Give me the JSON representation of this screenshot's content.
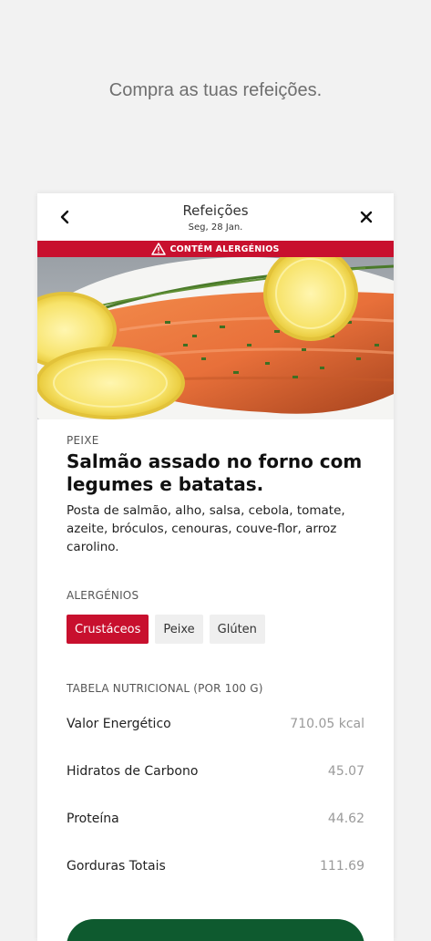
{
  "tagline": "Compra as tuas refeições.",
  "header": {
    "title": "Refeições",
    "date": "Seg, 28 Jan."
  },
  "banner": {
    "text": "CONTÉM ALERGÉNIOS",
    "icon": "warning-icon"
  },
  "meal": {
    "category": "PEIXE",
    "title": "Salmão assado no forno com legumes e batatas.",
    "description": "Posta de salmão, alho, salsa, cebola, tomate, azeite, bróculos, cenouras, couve-flor, arroz carolino."
  },
  "allergens": {
    "label": "ALERGÉNIOS",
    "tags": [
      {
        "label": "Crustáceos",
        "active": true
      },
      {
        "label": "Peixe",
        "active": false
      },
      {
        "label": "Glúten",
        "active": false
      }
    ]
  },
  "nutrition": {
    "label": "TABELA NUTRICIONAL (POR 100 G)",
    "rows": [
      {
        "name": "Valor Energético",
        "value": "710.05 kcal"
      },
      {
        "name": "Hidratos de Carbono",
        "value": "45.07"
      },
      {
        "name": "Proteína",
        "value": "44.62"
      },
      {
        "name": "Gorduras Totais",
        "value": "111.69"
      }
    ]
  },
  "colors": {
    "accent_red": "#c8102e",
    "button_green": "#0e5a2f",
    "background": "#f2f2f2"
  }
}
